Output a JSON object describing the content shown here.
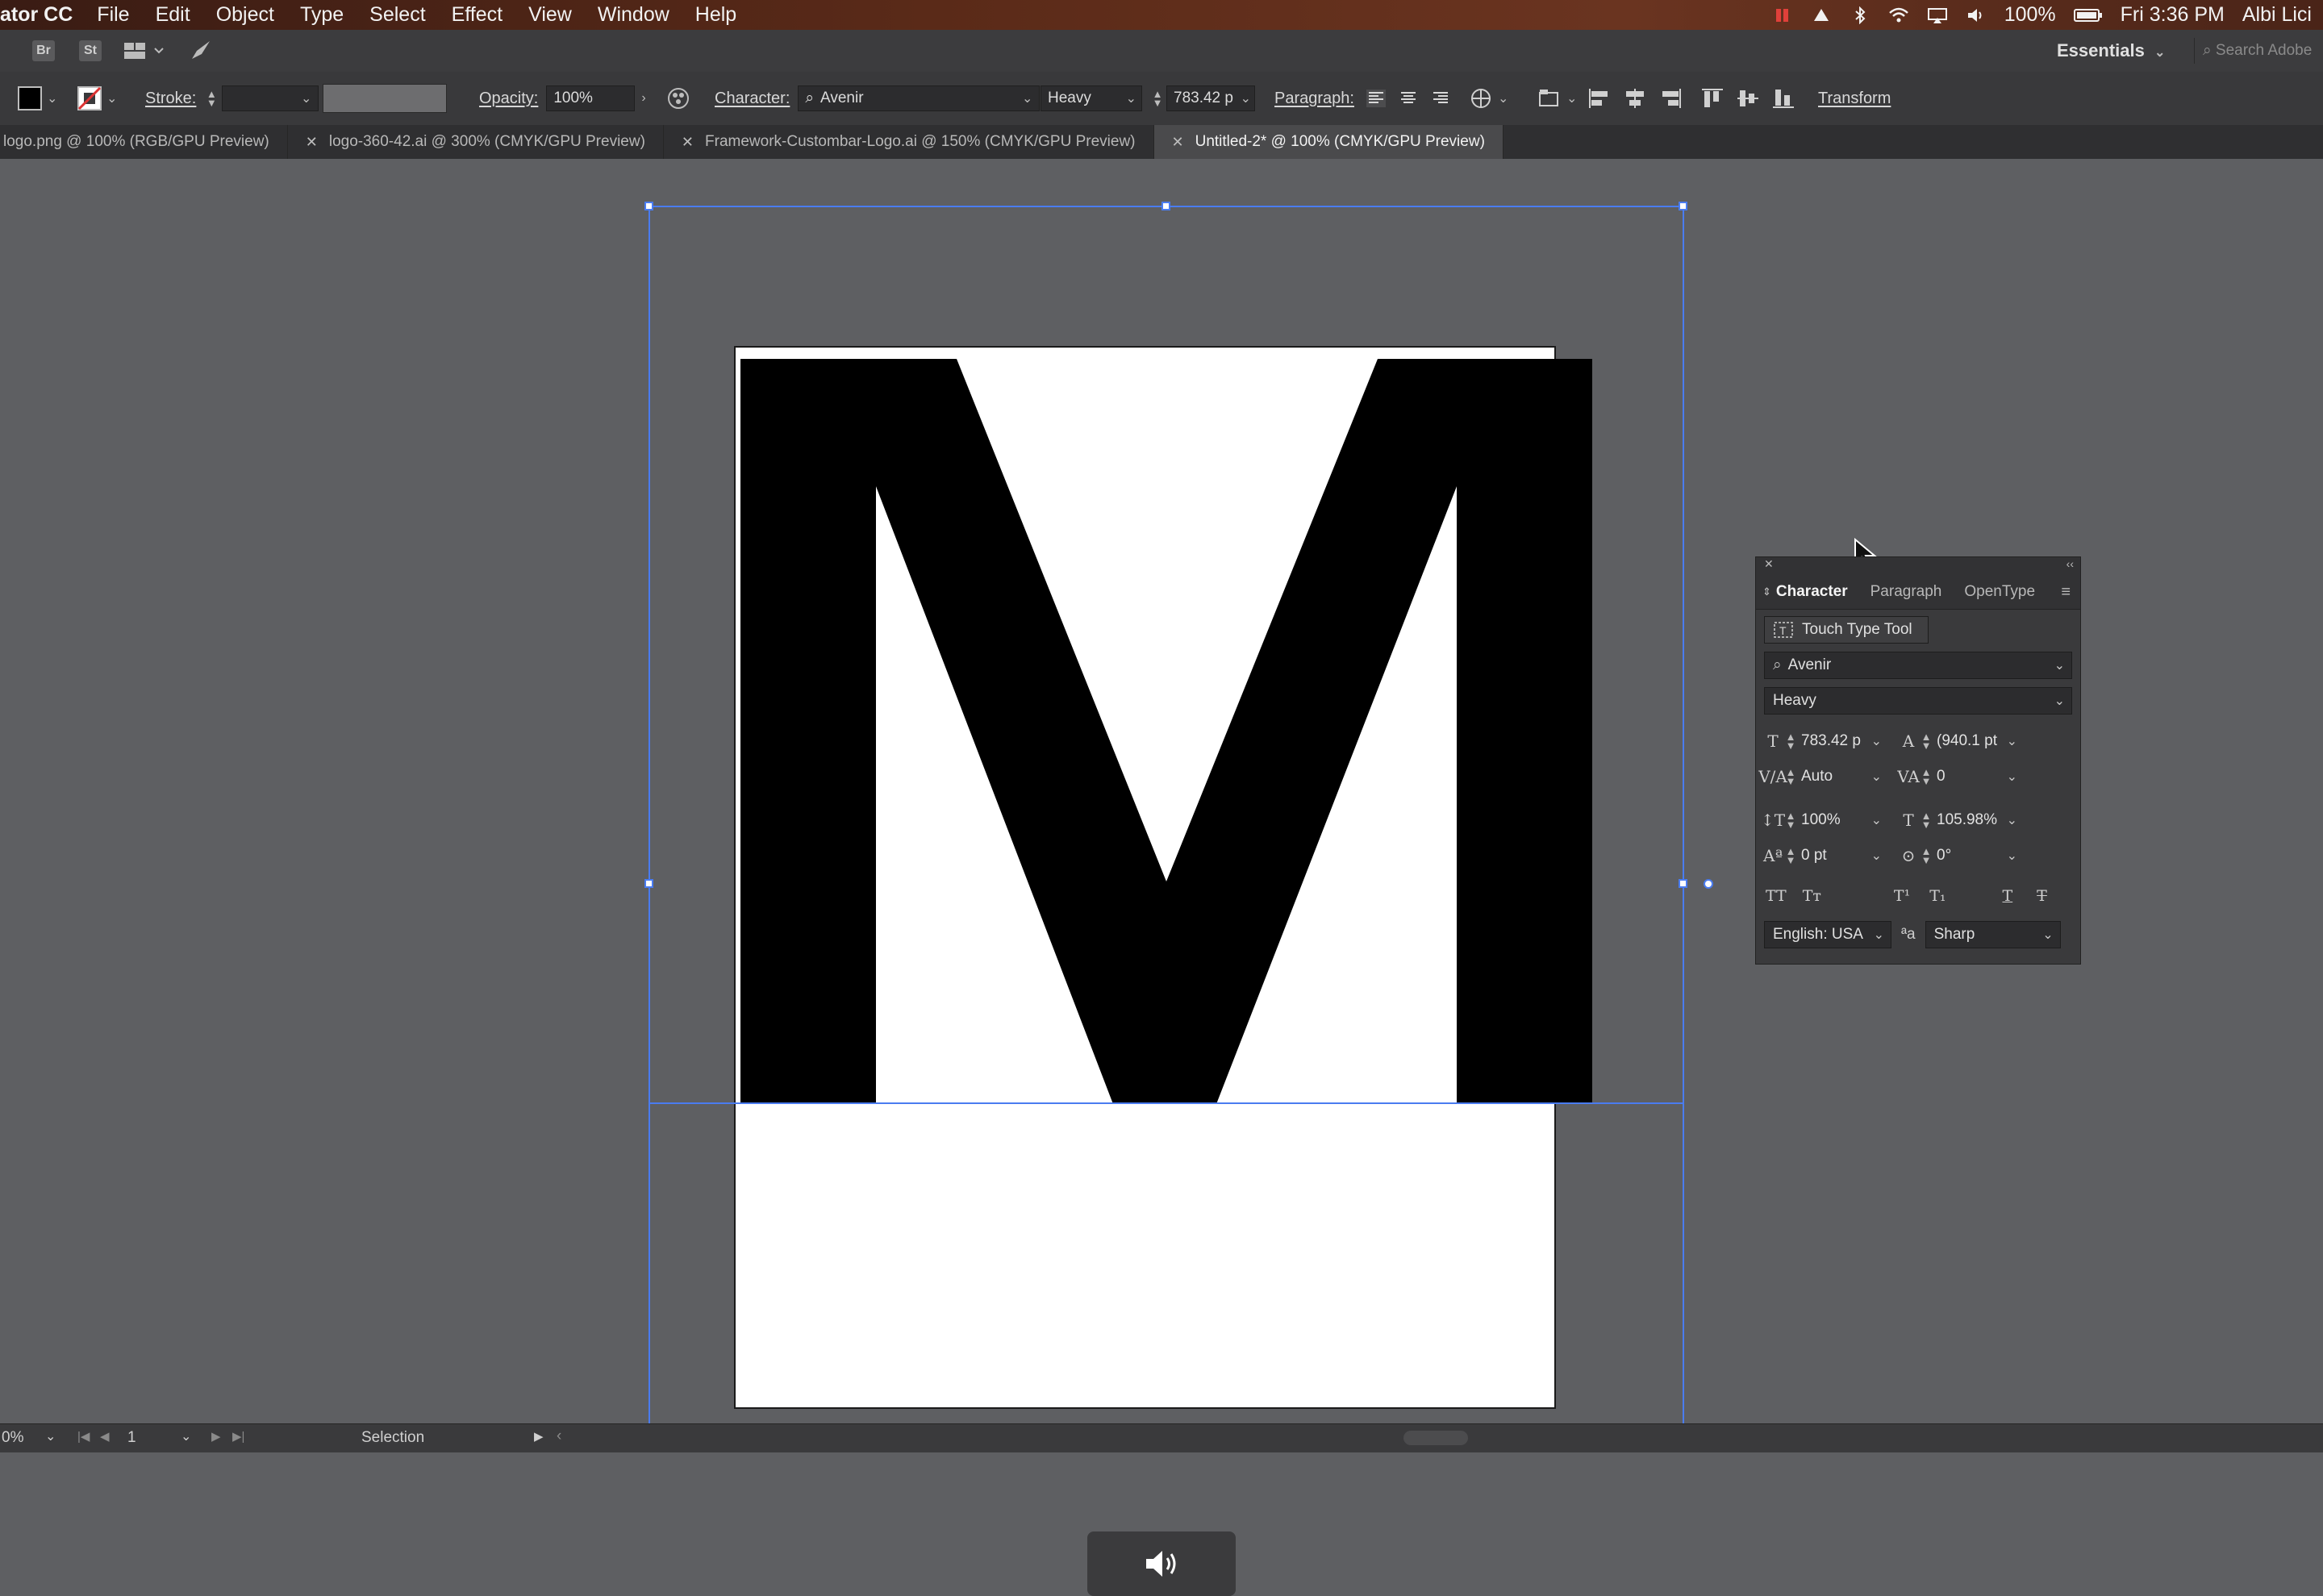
{
  "menubar": {
    "app_name": "ator CC",
    "items": [
      "File",
      "Edit",
      "Object",
      "Type",
      "Select",
      "Effect",
      "View",
      "Window",
      "Help"
    ],
    "battery": "100%",
    "clock": "Fri 3:36 PM",
    "user": "Albi Lici"
  },
  "appbar": {
    "bridge_label": "Br",
    "stock_label": "St",
    "workspace": "Essentials",
    "search_placeholder": "Search Adobe"
  },
  "controlbar": {
    "stroke_label": "Stroke:",
    "opacity_label": "Opacity:",
    "opacity_value": "100%",
    "character_label": "Character:",
    "font_family": "Avenir",
    "font_style": "Heavy",
    "font_size": "783.42 p",
    "paragraph_label": "Paragraph:",
    "transform_label": "Transform"
  },
  "tabs": [
    {
      "label": "logo.png @ 100% (RGB/GPU Preview)",
      "active": false
    },
    {
      "label": "logo-360-42.ai @ 300% (CMYK/GPU Preview)",
      "active": false
    },
    {
      "label": "Framework-Custombar-Logo.ai @ 150% (CMYK/GPU Preview)",
      "active": false
    },
    {
      "label": "Untitled-2* @ 100% (CMYK/GPU Preview)",
      "active": true
    }
  ],
  "canvas": {
    "glyph": "M"
  },
  "character_panel": {
    "tabs": [
      "Character",
      "Paragraph",
      "OpenType"
    ],
    "touch_type": "Touch Type Tool",
    "font_family": "Avenir",
    "font_style": "Heavy",
    "font_size": "783.42 p",
    "leading": "(940.1 pt",
    "kerning": "Auto",
    "tracking": "0",
    "vertical_scale": "100%",
    "horizontal_scale": "105.98%",
    "baseline_shift": "0 pt",
    "rotation": "0°",
    "language": "English: USA",
    "antialias_label": "ªa",
    "antialias": "Sharp"
  },
  "statusbar": {
    "zoom": "0%",
    "artboard_number": "1",
    "tool": "Selection"
  }
}
